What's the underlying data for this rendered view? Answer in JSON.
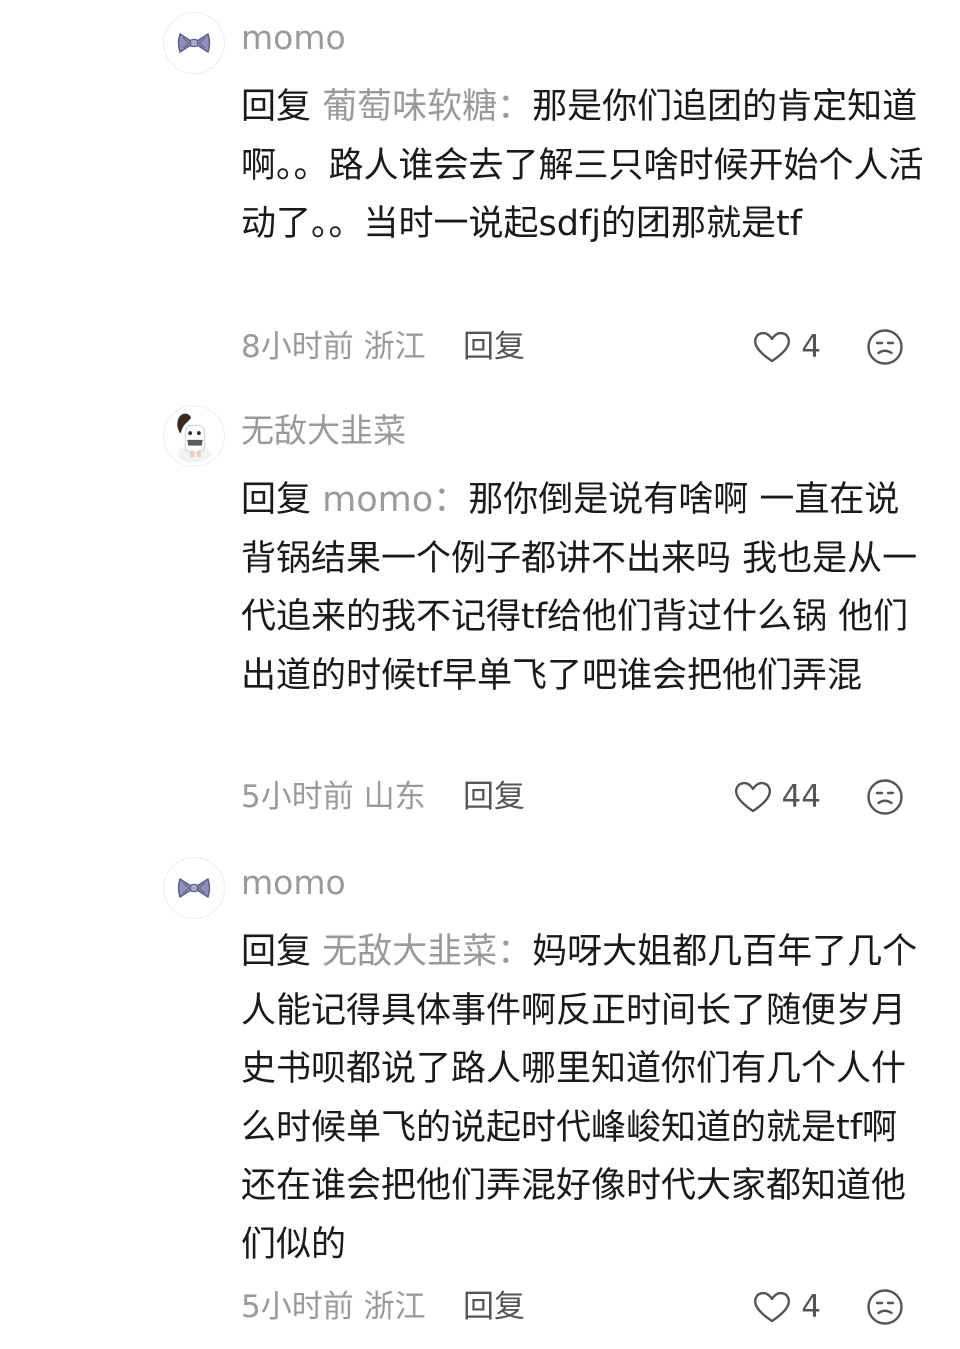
{
  "comments": [
    {
      "username": "momo",
      "avatar_icon": "bow-icon",
      "reply_prefix": "回复",
      "reply_target": "葡萄味软糖：",
      "content": "那是你们追团的肯定知道啊。。路人谁会去了解三只啥时候开始个人活动了。。当时一说起sdfj的团那就是tf",
      "time_location": "8小时前 浙江",
      "reply_label": "回复",
      "likes": "4"
    },
    {
      "username": "无敌大韭菜",
      "avatar_icon": "character-avatar-icon",
      "reply_prefix": "回复",
      "reply_target": "momo：",
      "content": "那你倒是说有啥啊 一直在说背锅结果一个例子都讲不出来吗 我也是从一代追来的我不记得tf给他们背过什么锅 他们出道的时候tf早单飞了吧谁会把他们弄混",
      "time_location": "5小时前 山东",
      "reply_label": "回复",
      "likes": "44"
    },
    {
      "username": "momo",
      "avatar_icon": "bow-icon",
      "reply_prefix": "回复",
      "reply_target": "无敌大韭菜：",
      "content": "妈呀大姐都几百年了几个人能记得具体事件啊反正时间长了随便岁月史书呗都说了路人哪里知道你们有几个人什么时候单飞的说起时代峰峻知道的就是tf啊还在谁会把他们弄混好像时代大家都知道他们似的",
      "time_location": "5小时前 浙江",
      "reply_label": "回复",
      "likes": "4"
    }
  ],
  "colors": {
    "text_primary": "#1a1a1a",
    "text_secondary": "#9a9a9a",
    "meta_action": "#555555",
    "bow_fill": "#8f8fb8"
  }
}
